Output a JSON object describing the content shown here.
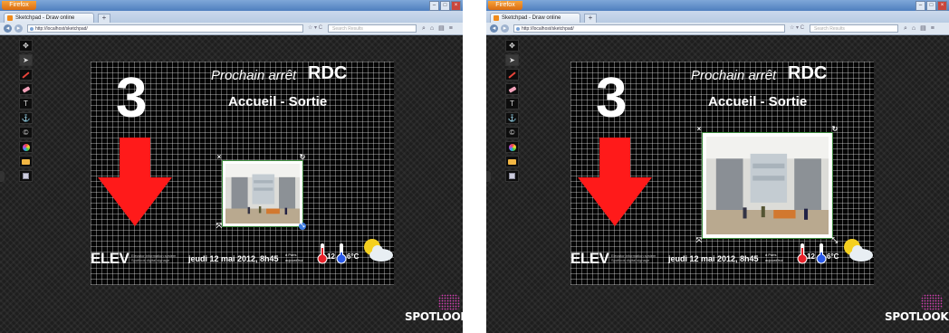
{
  "windows": [
    {
      "browser": {
        "app_button": "Firefox",
        "tab_title": "Sketchpad - Draw online",
        "new_tab": "+",
        "url": "http://localhost/sketchpad/",
        "search_placeholder": "Search Results"
      },
      "slide": {
        "prochain": "Prochain arrêt",
        "floor": "RDC",
        "destination": "Accueil - Sortie",
        "number": "3",
        "elev": "ELEV",
        "elev_sub1": "Elevator information system",
        "elev_sub2": "Spotlook digital signage",
        "date": "jeudi 12 mai 2012, 8h45",
        "weather_l1": "à Paris",
        "weather_l2": "aujourd'hui",
        "temp_hot": "12",
        "temp_cold": "6°C",
        "brand": "SPOTLOOK"
      },
      "photo_state": "small"
    },
    {
      "browser": {
        "app_button": "Firefox",
        "tab_title": "Sketchpad - Draw online",
        "new_tab": "+",
        "url": "http://localhost/sketchpad/",
        "search_placeholder": "Search Results"
      },
      "slide": {
        "prochain": "Prochain arrêt",
        "floor": "RDC",
        "destination": "Accueil - Sortie",
        "number": "3",
        "elev": "ELEV",
        "elev_sub1": "Elevator information system",
        "elev_sub2": "Spotlook digital signage",
        "date": "jeudi 12 mai 2012, 8h45",
        "weather_l1": "à Paris",
        "weather_l2": "aujourd'hui",
        "temp_hot": "12",
        "temp_cold": "6°C",
        "brand": "SPOTLOOK"
      },
      "photo_state": "enlarged"
    }
  ],
  "toolbar_icons": [
    "move-icon",
    "select-arrow-icon",
    "pen-icon",
    "eraser-icon",
    "text-icon",
    "anchor-icon",
    "copyright-icon",
    "color-picker-icon",
    "folder-icon",
    "save-icon"
  ],
  "colors": {
    "arrow": "#ff1a1a",
    "firefox": "#e8801e",
    "titlebar": "#5a86c4"
  }
}
